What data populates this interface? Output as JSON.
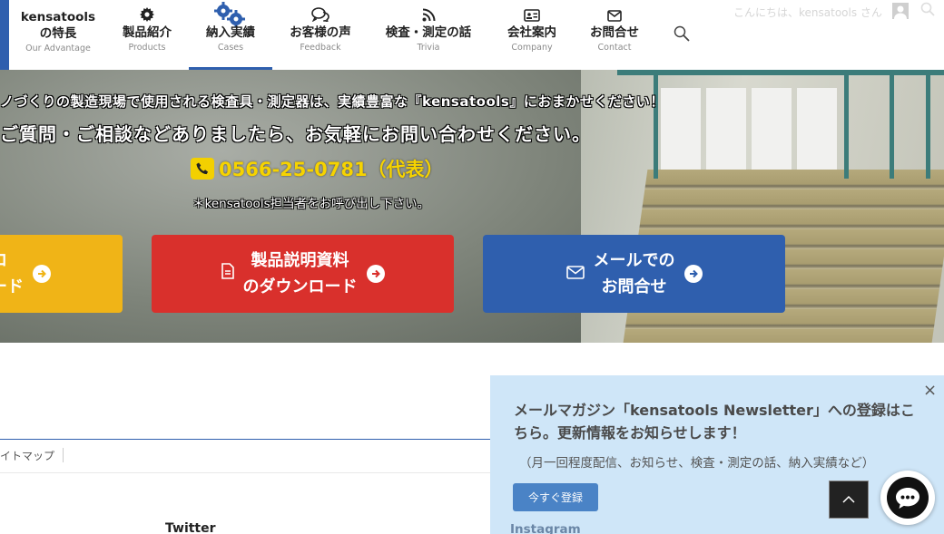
{
  "nav": {
    "first": {
      "jp_line1": "kensatools",
      "jp_line2": "の特長",
      "en": "Our Advantage"
    },
    "items": [
      {
        "jp": "製品紹介",
        "en": "Products",
        "icon": "gear-icon"
      },
      {
        "jp": "納入実績",
        "en": "Cases",
        "icon": "gears-icon"
      },
      {
        "jp": "お客様の声",
        "en": "Feedback",
        "icon": "chat-bubbles-icon"
      },
      {
        "jp": "検査・測定の話",
        "en": "Trivia",
        "icon": "rss-icon"
      },
      {
        "jp": "会社案内",
        "en": "Company",
        "icon": "id-card-icon"
      },
      {
        "jp": "お問合せ",
        "en": "Contact",
        "icon": "envelope-icon"
      }
    ],
    "greeting": "こんにちは、kensatools さん"
  },
  "hero": {
    "line1": "ノづくりの製造現場で使用される検査具・測定器は、実績豊富な『kensatools』におまかせください！",
    "line2": "ご質問・ご相談などありましたら、お気軽にお問い合わせください。",
    "phone": "0566-25-0781（代表）",
    "note": "＊kensatools担当者をお呼び出し下さい。",
    "cta_yellow": {
      "line1": "ロ",
      "line2": "ード"
    },
    "cta_red": {
      "line1": "製品説明資料",
      "line2": "のダウンロード"
    },
    "cta_blue": {
      "line1": "メールでの",
      "line2": "お問合せ"
    }
  },
  "footer": {
    "sitemap": "イトマップ",
    "twitter": "Twitter",
    "instagram": "Instagram"
  },
  "popup": {
    "title": "メールマガジン「kensatools Newsletter」への登録はこちら。更新情報をお知らせします！",
    "subtitle": "（月一回程度配信、お知らせ、検査・測定の話、納入実績など）",
    "button": "今すぐ登録",
    "close": "×"
  },
  "colors": {
    "brand_blue": "#2f5fae",
    "cta_yellow": "#f0b417",
    "cta_red": "#d9302c",
    "phone_yellow": "#f6d300",
    "popup_bg": "#cfe6f8"
  }
}
